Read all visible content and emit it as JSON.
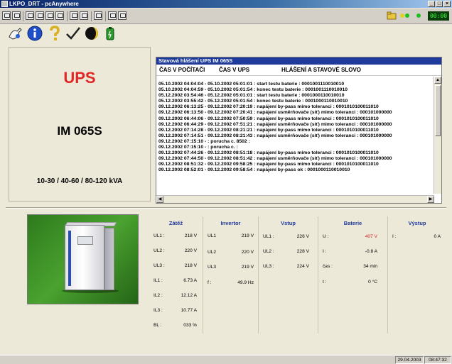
{
  "window": {
    "title": "LKPO_DRT - pcAnywhere",
    "buttons": [
      "_",
      "□",
      "×"
    ]
  },
  "toolbar": {
    "clock": "00:00"
  },
  "ups_panel": {
    "brand": "UPS",
    "model": "IM 065S",
    "rating": "10-30 / 40-60 / 80-120 kVA"
  },
  "log": {
    "title": "Stavová hlášení UPS IM 065S",
    "col_pc_time": "ČAS V POČÍTAČI",
    "col_ups_time": "ČAS V UPS",
    "col_message": "HLÁŠENÍ A STAVOVÉ SLOVO",
    "lines": [
      "05.10.2002 04:04:04 - 05.10.2002 05:01:01 : start testu baterie : 0001001110010010",
      "05.10.2002 04:04:59 - 05.10.2002 05:01:54 : konec testu baterie : 0001001110010010",
      "05.12.2002 03:54:46 - 05.12.2002 05:01:01 : start testu baterie : 0001000110010010",
      "05.12.2002 03:55:42 - 05.12.2002 05:01:54 : konec testu baterie : 0001000110010010",
      "09.12.2002 06:13:25 - 09.12.2002 07:20:19 : napájení by-pass mimo toleranci : 0001010100011010",
      "09.12.2002 06:13:50 - 09.12.2002 07:20:41 : napájení usměrňovače (síť) mimo toleranci : 000101000000",
      "09.12.2002 06:44:06 - 09.12.2002 07:50:59 : napájení by-pass mimo toleranci : 0001010100011010",
      "09.12.2002 06:44:29 - 09.12.2002 07:51:21 : napájení usměrňovače (síť) mimo toleranci : 000101000000",
      "09.12.2002 07:14:28 - 09.12.2002 08:21:21 : napájení by-pass mimo toleranci : 0001010100011010",
      "09.12.2002 07:14:51 - 09.12.2002 08:21:43 : napájení usměrňovače (síť) mimo toleranci : 000101000000",
      "09.12.2002 07:15:10 - : porucha c. 8502 :",
      "09.12.2002 07:15:10 - : porucha c. :",
      "09.12.2002 07:44:26 - 09.12.2002 08:51:18 : napájení by-pass mimo toleranci : 0001010100011010",
      "09.12.2002 07:44:50 - 09.12.2002 08:51:42 : napájení usměrňovače (síť) mimo toleranci : 000101000000",
      "09.12.2002 08:51:32 - 09.12.2002 09:58:25 : napájení by-pass mimo toleranci : 0001010100011010",
      "09.12.2002 08:52:01 - 09.12.2002 09:58:54 : napájení by-pass ok : 0001000110010010"
    ]
  },
  "measurements": {
    "zatez": {
      "title": "Zátěž",
      "rows": [
        {
          "label": "UL1 :",
          "value": "218 V"
        },
        {
          "label": "UL2 :",
          "value": "220 V"
        },
        {
          "label": "UL3 :",
          "value": "218 V"
        },
        {
          "label": "IL1 :",
          "value": "6.73 A"
        },
        {
          "label": "IL2 :",
          "value": "12.12 A"
        },
        {
          "label": "IL3 :",
          "value": "10.77 A"
        },
        {
          "label": "BL :",
          "value": "033 %"
        }
      ]
    },
    "invertor": {
      "title": "Invertor",
      "rows": [
        {
          "label": "UL1",
          "value": "219 V"
        },
        {
          "label": "UL2",
          "value": "220 V"
        },
        {
          "label": "UL3",
          "value": "219 V"
        },
        {
          "label": "f :",
          "value": "49.9 Hz"
        }
      ]
    },
    "vstup": {
      "title": "Vstup",
      "rows": [
        {
          "label": "UL1 :",
          "value": "226 V"
        },
        {
          "label": "UL2 :",
          "value": "228 V"
        },
        {
          "label": "UL3 :",
          "value": "224 V"
        }
      ]
    },
    "baterie": {
      "title": "Baterie",
      "rows": [
        {
          "label": "U :",
          "value": "407 V"
        },
        {
          "label": "I :",
          "value": "-0.8 A"
        },
        {
          "label": "čas :",
          "value": "34 min"
        },
        {
          "label": "t :",
          "value": "0 °C"
        }
      ]
    },
    "vystup": {
      "title": "Výstup",
      "rows": [
        {
          "label": "I :",
          "value": "0 A"
        }
      ]
    }
  },
  "statusbar": {
    "date": "29.04.2003",
    "time": "08:47:32"
  },
  "colors": {
    "accent_red": "#e02828",
    "header_blue": "#1e3a9c"
  }
}
